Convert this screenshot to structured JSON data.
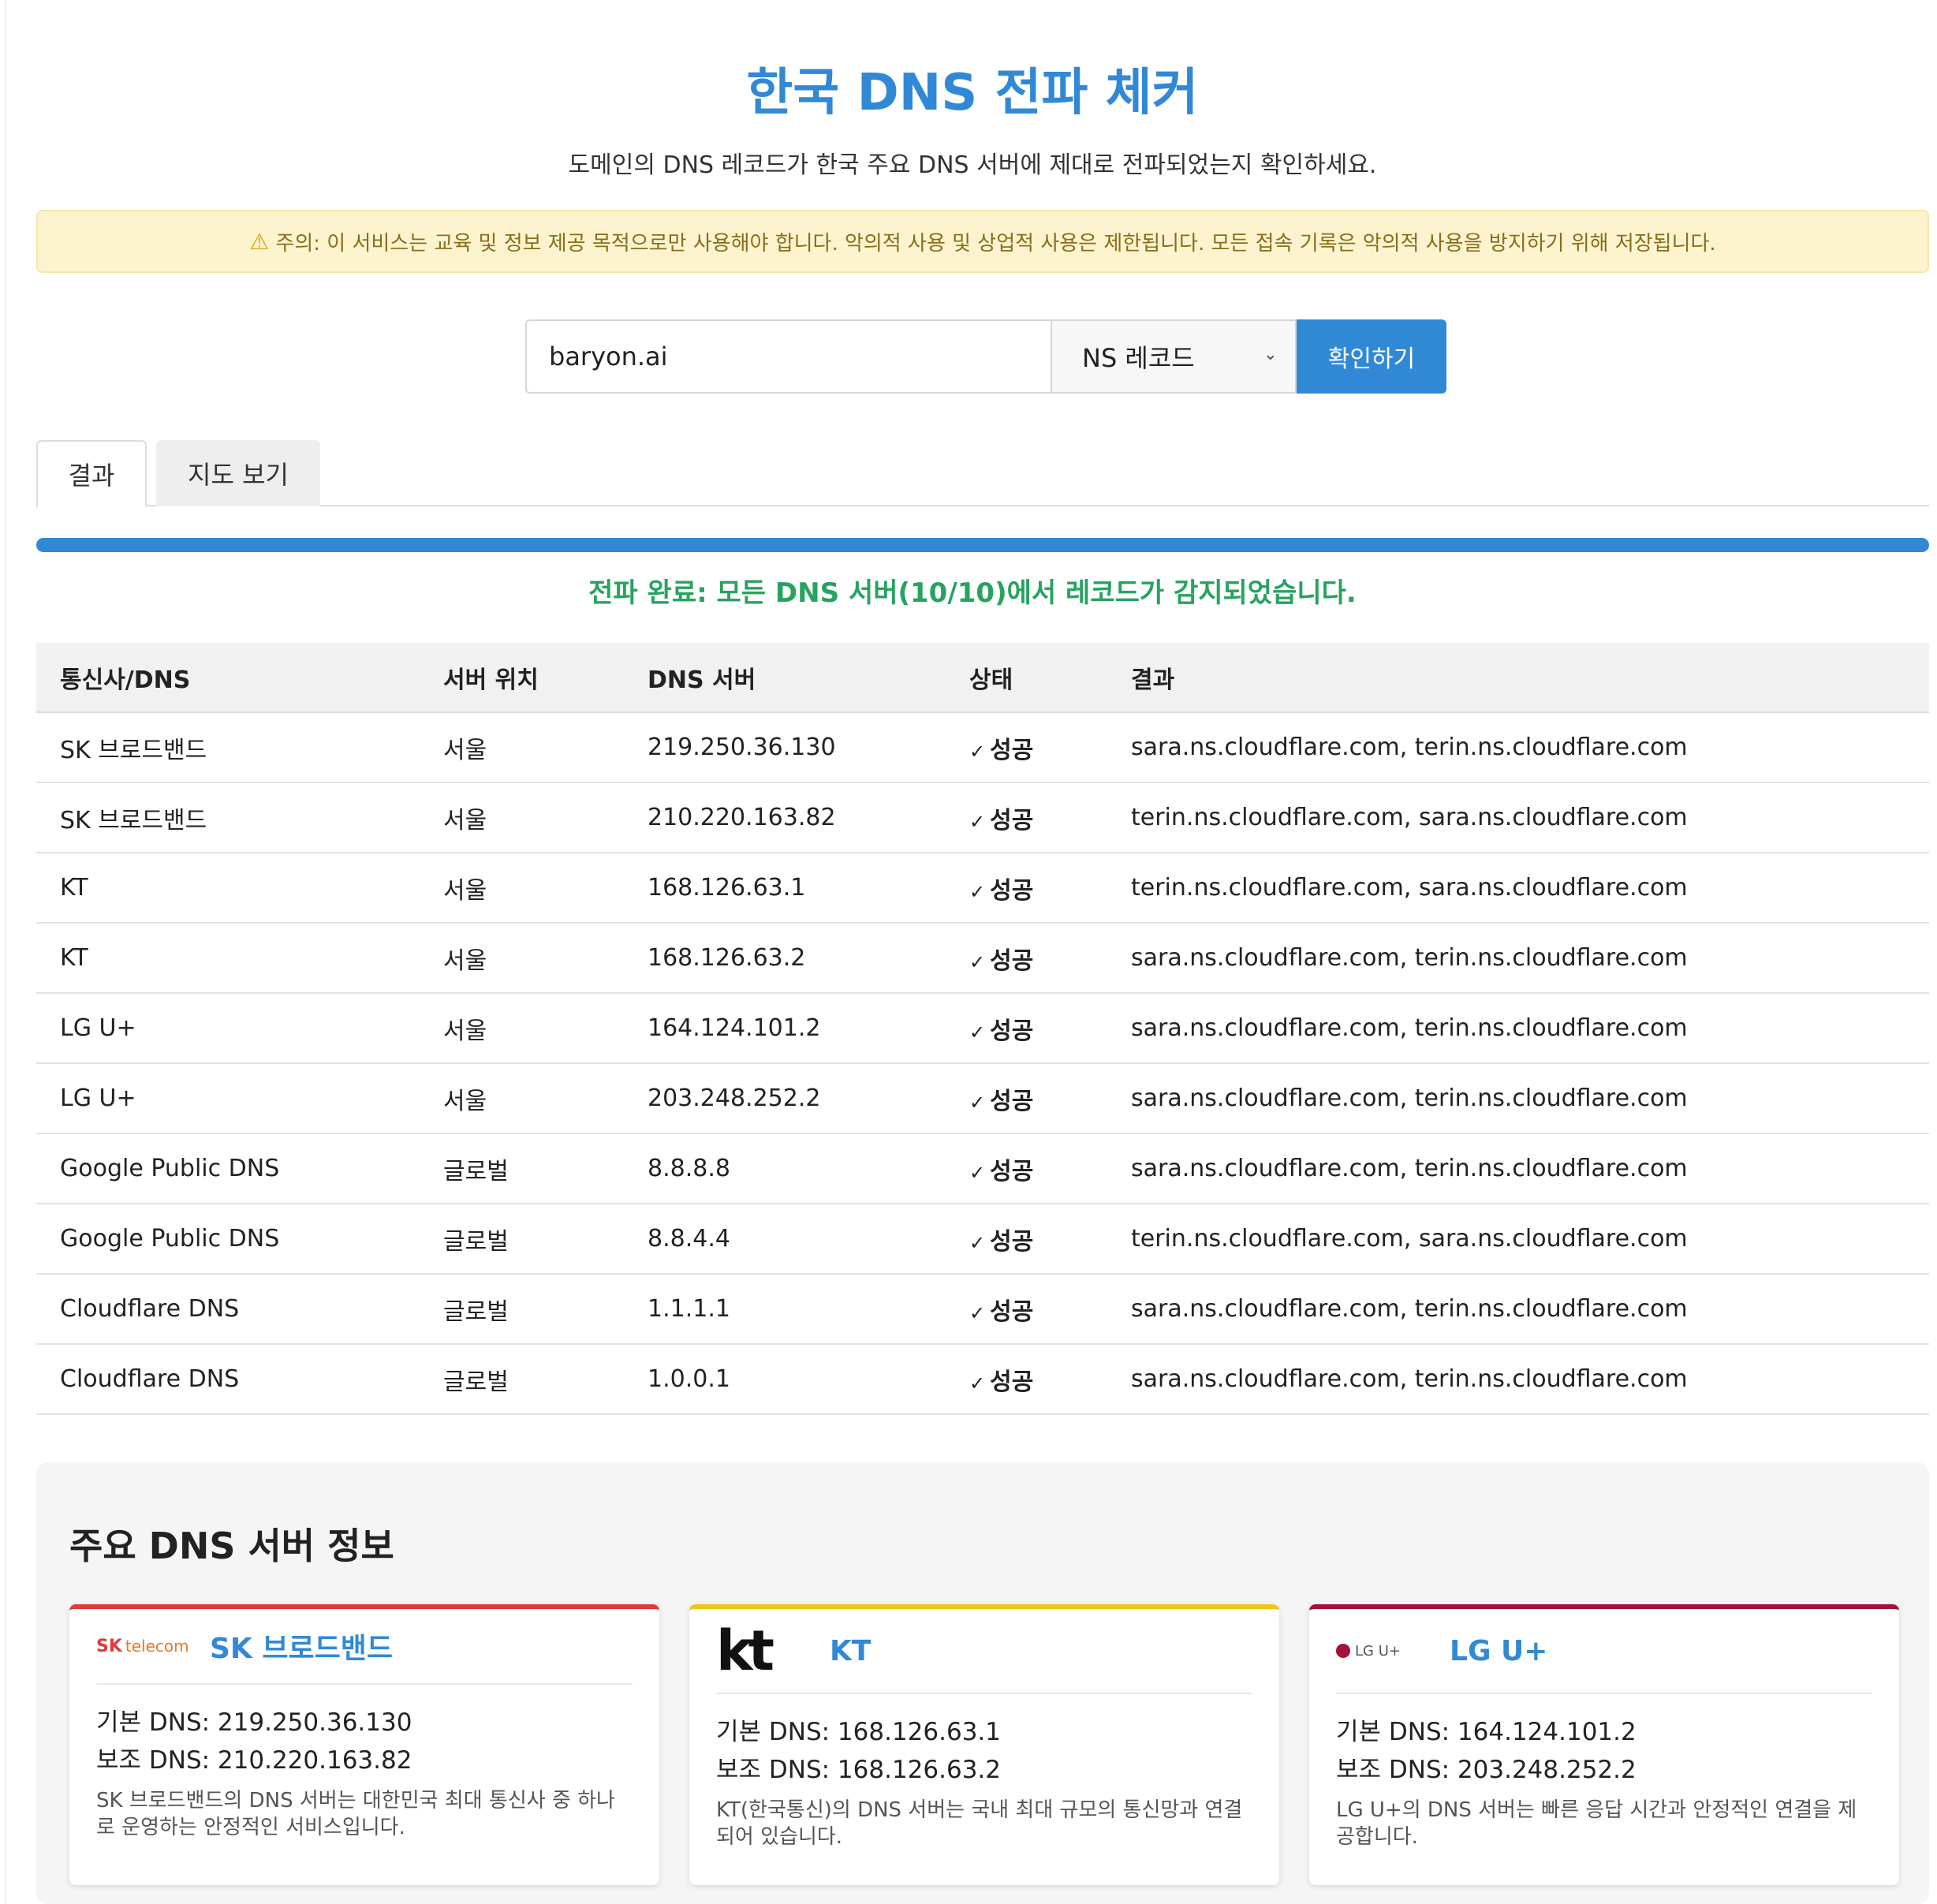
{
  "header": {
    "title": "한국 DNS 전파 체커",
    "subtitle": "도메인의 DNS 레코드가 한국 주요 DNS 서버에 제대로 전파되었는지 확인하세요."
  },
  "warning": {
    "icon": "warning-icon",
    "text": "주의: 이 서비스는 교육 및 정보 제공 목적으로만 사용해야 합니다. 악의적 사용 및 상업적 사용은 제한됩니다. 모든 접속 기록은 악의적 사용을 방지하기 위해 저장됩니다."
  },
  "search": {
    "domain_value": "baryon.ai",
    "record_type": "NS 레코드",
    "submit_label": "확인하기"
  },
  "tabs": [
    {
      "label": "결과",
      "active": true
    },
    {
      "label": "지도 보기",
      "active": false
    }
  ],
  "progress": {
    "percent": 100,
    "color": "#3189d6"
  },
  "status_message": "전파 완료: 모든 DNS 서버(10/10)에서 레코드가 감지되었습니다.",
  "table": {
    "headers": [
      "통신사/DNS",
      "서버 위치",
      "DNS 서버",
      "상태",
      "결과"
    ],
    "rows": [
      {
        "provider": "SK 브로드밴드",
        "location": "서울",
        "server": "219.250.36.130",
        "status": "성공",
        "result": "sara.ns.cloudflare.com, terin.ns.cloudflare.com"
      },
      {
        "provider": "SK 브로드밴드",
        "location": "서울",
        "server": "210.220.163.82",
        "status": "성공",
        "result": "terin.ns.cloudflare.com, sara.ns.cloudflare.com"
      },
      {
        "provider": "KT",
        "location": "서울",
        "server": "168.126.63.1",
        "status": "성공",
        "result": "terin.ns.cloudflare.com, sara.ns.cloudflare.com"
      },
      {
        "provider": "KT",
        "location": "서울",
        "server": "168.126.63.2",
        "status": "성공",
        "result": "sara.ns.cloudflare.com, terin.ns.cloudflare.com"
      },
      {
        "provider": "LG U+",
        "location": "서울",
        "server": "164.124.101.2",
        "status": "성공",
        "result": "sara.ns.cloudflare.com, terin.ns.cloudflare.com"
      },
      {
        "provider": "LG U+",
        "location": "서울",
        "server": "203.248.252.2",
        "status": "성공",
        "result": "sara.ns.cloudflare.com, terin.ns.cloudflare.com"
      },
      {
        "provider": "Google Public DNS",
        "location": "글로벌",
        "server": "8.8.8.8",
        "status": "성공",
        "result": "sara.ns.cloudflare.com, terin.ns.cloudflare.com"
      },
      {
        "provider": "Google Public DNS",
        "location": "글로벌",
        "server": "8.8.4.4",
        "status": "성공",
        "result": "terin.ns.cloudflare.com, sara.ns.cloudflare.com"
      },
      {
        "provider": "Cloudflare DNS",
        "location": "글로벌",
        "server": "1.1.1.1",
        "status": "성공",
        "result": "sara.ns.cloudflare.com, terin.ns.cloudflare.com"
      },
      {
        "provider": "Cloudflare DNS",
        "location": "글로벌",
        "server": "1.0.0.1",
        "status": "성공",
        "result": "sara.ns.cloudflare.com, terin.ns.cloudflare.com"
      }
    ]
  },
  "info": {
    "title": "주요 DNS 서버 정보",
    "cards": [
      {
        "name": "SK 브로드밴드",
        "logo_main": "SK",
        "logo_sub": "telecom",
        "primary": "기본 DNS: 219.250.36.130",
        "secondary": "보조 DNS: 210.220.163.82",
        "desc": "SK 브로드밴드의 DNS 서버는 대한민국 최대 통신사 중 하나로 운영하는 안정적인 서비스입니다.",
        "accent": "#e03a3a"
      },
      {
        "name": "KT",
        "logo_main": "kt",
        "primary": "기본 DNS: 168.126.63.1",
        "secondary": "보조 DNS: 168.126.63.2",
        "desc": "KT(한국통신)의 DNS 서버는 국내 최대 규모의 통신망과 연결되어 있습니다.",
        "accent": "#f0c419"
      },
      {
        "name": "LG U+",
        "logo_main": "LG U+",
        "primary": "기본 DNS: 164.124.101.2",
        "secondary": "보조 DNS: 203.248.252.2",
        "desc": "LG U+의 DNS 서버는 빠른 응답 시간과 안정적인 연결을 제공합니다.",
        "accent": "#a3123a"
      }
    ]
  }
}
